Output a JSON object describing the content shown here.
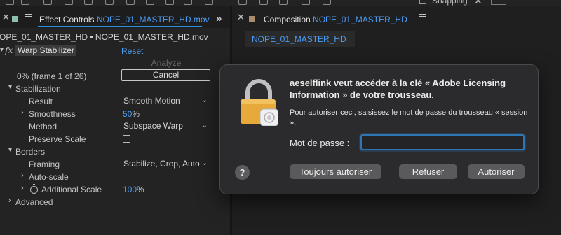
{
  "toolbar": {
    "snapping_label": "Snapping",
    "icons": [
      "hand-icon",
      "zoom-icon",
      "rotate-icon",
      "camera-icon",
      "pan-icon",
      "rectangle-icon",
      "pen-icon",
      "text-icon",
      "brush-icon",
      "clone-icon",
      "eraser-icon",
      "roto-icon",
      "puppet-icon",
      "snapping-checkbox",
      "expand-icon"
    ]
  },
  "effect_controls": {
    "tab_prefix": "Effect Controls",
    "tab_file": "NOPE_01_MASTER_HD.mov",
    "layer_path": "OPE_01_MASTER_HD • NOPE_01_MASTER_HD.mov",
    "effect": {
      "name": "Warp Stabilizer",
      "reset_label": "Reset",
      "analyze_label": "Analyze",
      "progress_text": "0% (frame 1 of 26)",
      "cancel_label": "Cancel"
    },
    "stabilization": {
      "label": "Stabilization",
      "result_label": "Result",
      "result_value": "Smooth Motion",
      "smoothness_label": "Smoothness",
      "smoothness_value": "50",
      "smoothness_unit": "%",
      "method_label": "Method",
      "method_value": "Subspace Warp",
      "preserve_scale_label": "Preserve Scale",
      "preserve_scale_checked": false
    },
    "borders": {
      "label": "Borders",
      "framing_label": "Framing",
      "framing_value": "Stabilize, Crop, Auto",
      "auto_scale_label": "Auto-scale",
      "additional_scale_label": "Additional Scale",
      "additional_scale_value": "100",
      "additional_scale_unit": "%"
    },
    "advanced_label": "Advanced"
  },
  "composition": {
    "tab_prefix": "Composition",
    "tab_name": "NOPE_01_MASTER_HD",
    "subtab": "NOPE_01_MASTER_HD"
  },
  "dialog": {
    "title": "aeselflink veut accéder à la clé « Adobe Licensing Information » de votre trousseau.",
    "body": "Pour autoriser ceci, saisissez le mot de passe du trousseau « session ».",
    "password_label": "Mot de passe :",
    "password_value": "",
    "help_label": "?",
    "always_allow_label": "Toujours autoriser",
    "deny_label": "Refuser",
    "allow_label": "Autoriser"
  },
  "colors": {
    "accent_blue": "#4b9df4",
    "tab_underline": "#2b8ee0",
    "effect_swatch": "#8fbfb1",
    "comp_swatch": "#a88c6c",
    "lock_gold": "#e7a93a",
    "focus_ring": "#2f77b4"
  }
}
